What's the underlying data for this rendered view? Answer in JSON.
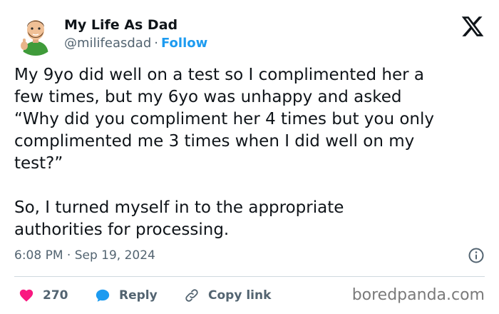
{
  "author": {
    "name": "My Life As Dad",
    "handle": "@milifeasdad",
    "separator": "·",
    "follow_label": "Follow"
  },
  "tweet": {
    "text": "My 9yo did well on a test so I complimented her a\nfew times, but my 6yo was unhappy and asked\n“Why did you compliment her 4 times but you only\ncomplimented me 3 times when I did well on my\ntest?”\n\nSo, I turned myself in to the appropriate\nauthorities for processing.",
    "timestamp": "6:08 PM · Sep 19, 2024"
  },
  "actions": {
    "like_count": "270",
    "reply_label": "Reply",
    "copy_link_label": "Copy link"
  },
  "watermark": "boredpanda.com",
  "icons": {
    "platform": "x-logo-icon",
    "info": "info-icon",
    "like": "heart-icon",
    "reply": "reply-bubble-icon",
    "copy": "link-icon"
  },
  "colors": {
    "follow": "#1d9bf0",
    "heart": "#f91880",
    "reply_bubble": "#1d9bf0",
    "muted": "#536471",
    "text": "#0f1419"
  }
}
